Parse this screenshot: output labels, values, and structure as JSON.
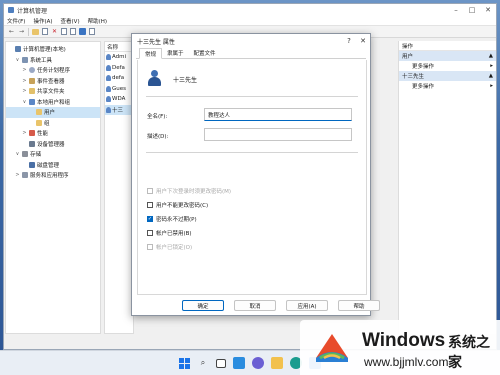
{
  "window": {
    "title": "计算机管理"
  },
  "menu": [
    "文件(F)",
    "操作(A)",
    "查看(V)",
    "帮助(H)"
  ],
  "tree": [
    {
      "label": "计算机管理(本地)",
      "depth": 0,
      "twisty": "",
      "icon": "computer-icon"
    },
    {
      "label": "系统工具",
      "depth": 1,
      "twisty": "∨",
      "icon": "tools-icon"
    },
    {
      "label": "任务计划程序",
      "depth": 2,
      "twisty": ">",
      "icon": "clock-icon"
    },
    {
      "label": "事件查看器",
      "depth": 2,
      "twisty": ">",
      "icon": "event-log-icon"
    },
    {
      "label": "共享文件夹",
      "depth": 2,
      "twisty": ">",
      "icon": "shared-folder-icon"
    },
    {
      "label": "本地用户和组",
      "depth": 2,
      "twisty": "∨",
      "icon": "users-icon"
    },
    {
      "label": "用户",
      "depth": 3,
      "twisty": "",
      "icon": "folder-icon",
      "selected": true
    },
    {
      "label": "组",
      "depth": 3,
      "twisty": "",
      "icon": "folder-icon"
    },
    {
      "label": "性能",
      "depth": 2,
      "twisty": ">",
      "icon": "performance-icon"
    },
    {
      "label": "设备管理器",
      "depth": 2,
      "twisty": "",
      "icon": "device-icon"
    },
    {
      "label": "存储",
      "depth": 1,
      "twisty": "∨",
      "icon": "storage-icon"
    },
    {
      "label": "磁盘管理",
      "depth": 2,
      "twisty": "",
      "icon": "disk-icon"
    },
    {
      "label": "服务和应用程序",
      "depth": 1,
      "twisty": ">",
      "icon": "services-icon"
    }
  ],
  "list": {
    "header": "名称",
    "rows": [
      "Admi",
      "Defa",
      "defa",
      "Gues",
      "WDA",
      "十三"
    ]
  },
  "actions": {
    "header": "操作",
    "groups": [
      {
        "title": "用户",
        "item": "更多操作"
      },
      {
        "title": "十三先生",
        "item": "更多操作"
      }
    ]
  },
  "dialog": {
    "title": "十三先生 属性",
    "tabs": [
      "常规",
      "隶属于",
      "配置文件"
    ],
    "username": "十三先生",
    "fullname_label": "全名(F):",
    "fullname_value": "教程达人",
    "description_label": "描述(D):",
    "description_value": "",
    "checkboxes": [
      {
        "label": "用户下次登录时须更改密码(M)",
        "checked": false,
        "disabled": true
      },
      {
        "label": "用户不能更改密码(C)",
        "checked": false,
        "disabled": false
      },
      {
        "label": "密码永不过期(P)",
        "checked": true,
        "disabled": false
      },
      {
        "label": "帐户已禁用(B)",
        "checked": false,
        "disabled": false
      },
      {
        "label": "帐户已锁定(O)",
        "checked": false,
        "disabled": true
      }
    ],
    "buttons": {
      "ok": "确定",
      "cancel": "取消",
      "apply": "应用(A)",
      "help": "帮助"
    }
  },
  "watermark": {
    "title": "Windows",
    "cn": "系统之家",
    "url": "www.bjjmlv.com"
  }
}
